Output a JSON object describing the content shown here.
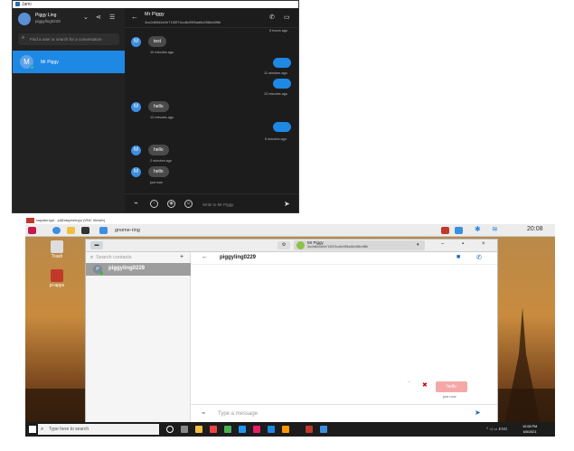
{
  "jami": {
    "window_title": "Jami",
    "account": {
      "name": "Piggy Ling",
      "id": "piggyling0229"
    },
    "search_placeholder": "Find a user or search for a conversation",
    "contact": {
      "initial": "M",
      "name": "Mr Piggy"
    },
    "chat": {
      "peer_name": "Mr Piggy",
      "peer_id": "3cc0d65d4e2e7150f74cc8c09f5ad5c056bc5f8b",
      "top_time": "5 hours ago",
      "messages": [
        {
          "dir": "in",
          "text": "test",
          "time": "10 minutes ago"
        },
        {
          "dir": "out",
          "time": "11 minutes ago"
        },
        {
          "dir": "out",
          "time": "12 minutes ago"
        },
        {
          "dir": "in",
          "text": "hello",
          "time": "12 minutes ago"
        },
        {
          "dir": "out",
          "time": "5 minutes ago"
        },
        {
          "dir": "in",
          "text": "hello",
          "time": "2 minutes ago"
        },
        {
          "dir": "in",
          "text": "hello",
          "time": "just now"
        }
      ],
      "input_placeholder": "Write to Mr Piggy"
    }
  },
  "desktop": {
    "titlebar_text": "raspberrypi - pi@raspberrypi (VNC Viewer)",
    "taskbar_app": "gnome-ring",
    "clock": "20:08",
    "icons": [
      {
        "label": "Trash"
      },
      {
        "label": "pi-apps"
      }
    ],
    "gnome_ring": {
      "account_name": "Mr Piggy",
      "account_id": "3cc0d65d4e2e7150f74cc8c09f5ad5c056bc5f8b",
      "search_placeholder": "Search contacts",
      "contact": {
        "initial": "P",
        "name": "piggyling0229"
      },
      "peer_name": "piggyling0229",
      "sent_message": "hello",
      "sent_time": "just now",
      "input_placeholder": "Type a message"
    }
  },
  "windows_taskbar": {
    "search_placeholder": "Type here to search",
    "time": "10:08 PM",
    "date": "6/5/2021"
  }
}
